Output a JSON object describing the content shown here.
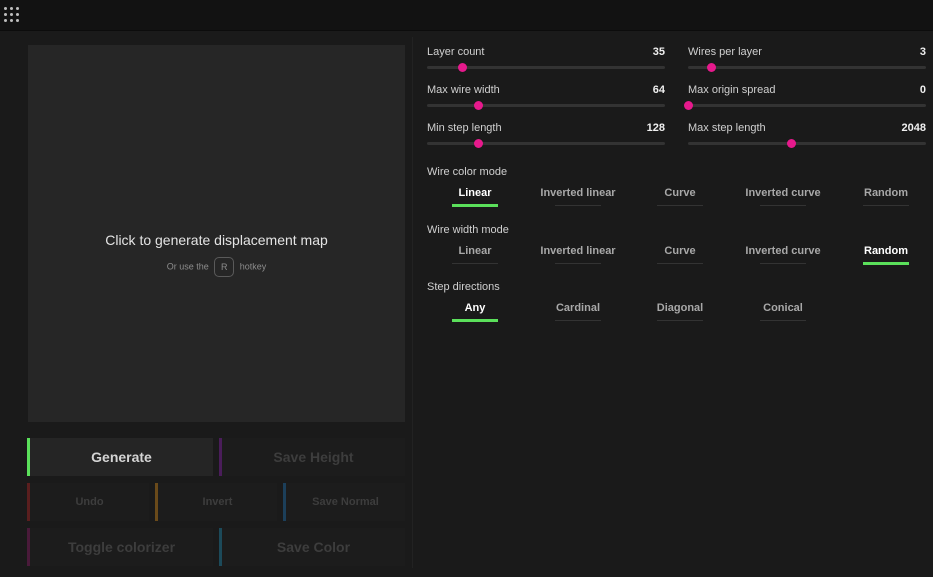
{
  "header": {
    "menu_icon": "apps-grid-icon"
  },
  "preview": {
    "title": "Click to generate displacement map",
    "hint_prefix": "Or use the",
    "hotkey": "R",
    "hint_suffix": "hotkey"
  },
  "buttons": {
    "generate": "Generate",
    "save_height": "Save Height",
    "undo": "Undo",
    "invert": "Invert",
    "save_normal": "Save Normal",
    "toggle_colorizer": "Toggle colorizer",
    "save_color": "Save Color"
  },
  "colors": {
    "accent_thumb": "#e6198c",
    "selected_underline": "#5be05b",
    "generate_bar": "#5be05b",
    "save_height_bar": "#4a1d5a",
    "undo_bar": "#5a1e1e",
    "invert_bar": "#6a4a1a",
    "save_normal_bar": "#1c3f5a",
    "toggle_colorizer_bar": "#4a1a3a",
    "save_color_bar": "#1c4a5a"
  },
  "sliders": [
    {
      "label": "Layer count",
      "value": "35",
      "fraction": 0.146
    },
    {
      "label": "Wires per layer",
      "value": "3",
      "fraction": 0.096
    },
    {
      "label": "Max wire width",
      "value": "64",
      "fraction": 0.213
    },
    {
      "label": "Max origin spread",
      "value": "0",
      "fraction": 0.0
    },
    {
      "label": "Min step length",
      "value": "128",
      "fraction": 0.213
    },
    {
      "label": "Max step length",
      "value": "2048",
      "fraction": 0.431
    }
  ],
  "wire_color_mode": {
    "label": "Wire color mode",
    "options": [
      "Linear",
      "Inverted linear",
      "Curve",
      "Inverted curve",
      "Random"
    ],
    "selected": "Linear"
  },
  "wire_width_mode": {
    "label": "Wire width mode",
    "options": [
      "Linear",
      "Inverted linear",
      "Curve",
      "Inverted curve",
      "Random"
    ],
    "selected": "Random"
  },
  "step_directions": {
    "label": "Step directions",
    "options": [
      "Any",
      "Cardinal",
      "Diagonal",
      "Conical"
    ],
    "selected": "Any"
  }
}
